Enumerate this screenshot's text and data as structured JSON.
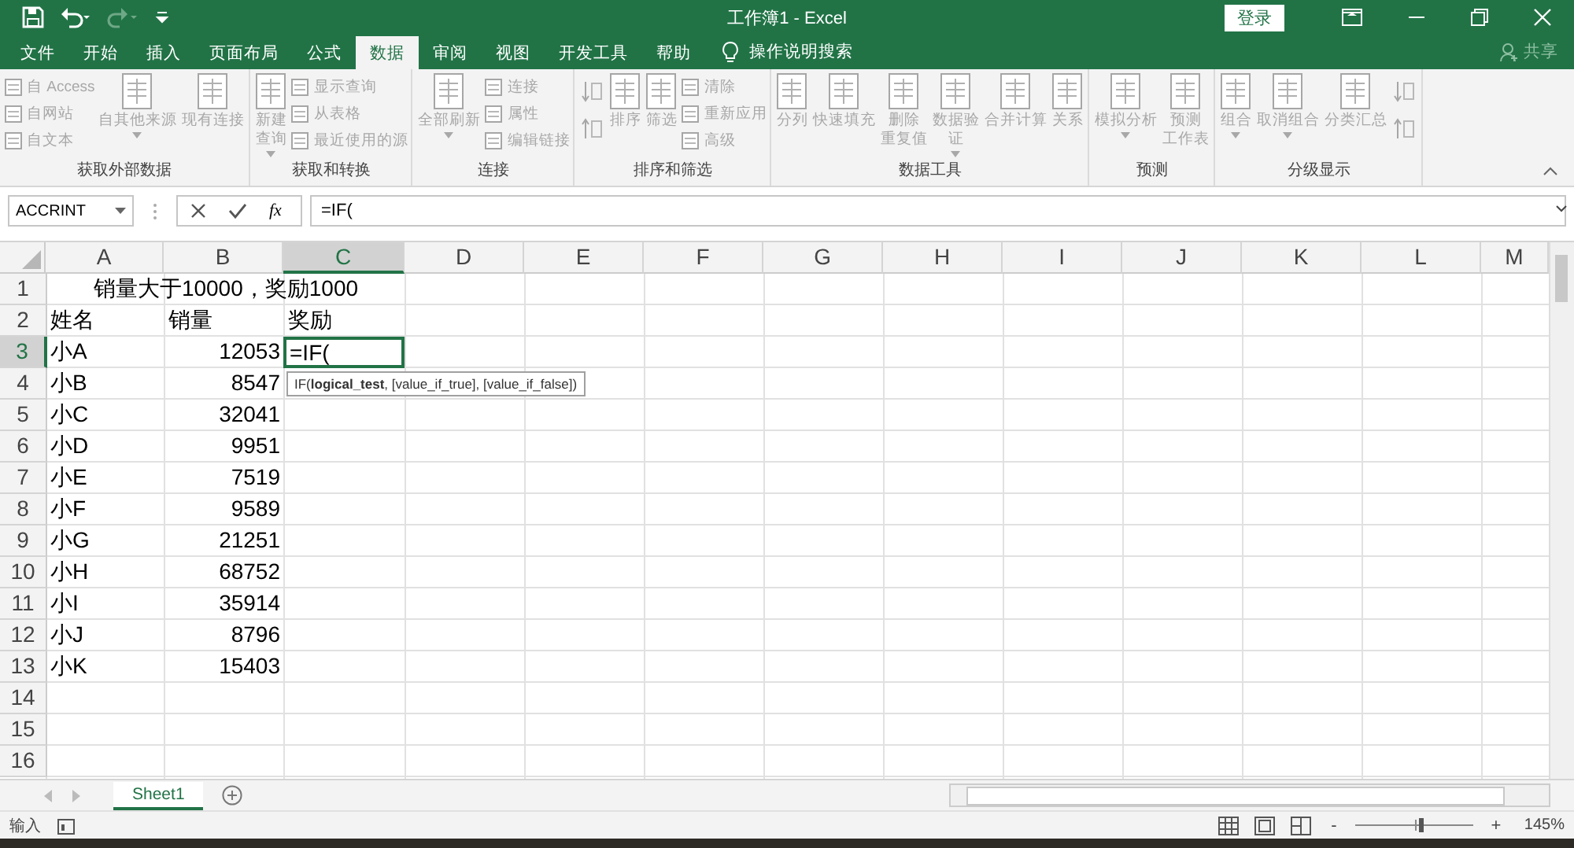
{
  "window": {
    "title": "工作簿1 - Excel",
    "signin": "登录",
    "share": "共享"
  },
  "tabs": [
    {
      "label": "文件",
      "selected": false
    },
    {
      "label": "开始",
      "selected": false
    },
    {
      "label": "插入",
      "selected": false
    },
    {
      "label": "页面布局",
      "selected": false
    },
    {
      "label": "公式",
      "selected": false
    },
    {
      "label": "数据",
      "selected": true
    },
    {
      "label": "审阅",
      "selected": false
    },
    {
      "label": "视图",
      "selected": false
    },
    {
      "label": "开发工具",
      "selected": false
    },
    {
      "label": "帮助",
      "selected": false
    }
  ],
  "tell_me": "操作说明搜索",
  "ribbon": {
    "disabled": true,
    "groups": [
      {
        "label": "获取外部数据",
        "columns": [
          {
            "kind": "stack",
            "items": [
              "自 Access",
              "自网站",
              "自文本"
            ]
          },
          {
            "kind": "large",
            "lines": [
              "自其他来源"
            ],
            "dropdown": true
          },
          {
            "kind": "large",
            "lines": [
              "现有连接"
            ],
            "dropdown": false
          }
        ]
      },
      {
        "label": "获取和转换",
        "columns": [
          {
            "kind": "large",
            "lines": [
              "新建",
              "查询"
            ],
            "dropdown": true
          },
          {
            "kind": "stack",
            "items": [
              "显示查询",
              "从表格",
              "最近使用的源"
            ]
          }
        ]
      },
      {
        "label": "连接",
        "columns": [
          {
            "kind": "large",
            "lines": [
              "全部刷新"
            ],
            "dropdown": true
          },
          {
            "kind": "stack",
            "items": [
              "连接",
              "属性",
              "编辑链接"
            ]
          }
        ]
      },
      {
        "label": "排序和筛选",
        "columns": [
          {
            "kind": "icons"
          },
          {
            "kind": "large",
            "lines": [
              "排序"
            ],
            "dropdown": false
          },
          {
            "kind": "large",
            "lines": [
              "筛选"
            ],
            "dropdown": false
          },
          {
            "kind": "stack",
            "items": [
              "清除",
              "重新应用",
              "高级"
            ]
          }
        ]
      },
      {
        "label": "数据工具",
        "columns": [
          {
            "kind": "large",
            "lines": [
              "分列"
            ],
            "dropdown": false
          },
          {
            "kind": "large",
            "lines": [
              "快速填充"
            ],
            "dropdown": false
          },
          {
            "kind": "large",
            "lines": [
              "删除",
              "重复值"
            ],
            "dropdown": false
          },
          {
            "kind": "large",
            "lines": [
              "数据验",
              "证"
            ],
            "dropdown": true
          },
          {
            "kind": "large",
            "lines": [
              "合并计算"
            ],
            "dropdown": false
          },
          {
            "kind": "large",
            "lines": [
              "关系"
            ],
            "dropdown": false
          }
        ]
      },
      {
        "label": "预测",
        "columns": [
          {
            "kind": "large",
            "lines": [
              "模拟分析"
            ],
            "dropdown": true
          },
          {
            "kind": "large",
            "lines": [
              "预测",
              "工作表"
            ],
            "dropdown": false
          }
        ]
      },
      {
        "label": "分级显示",
        "columns": [
          {
            "kind": "large",
            "lines": [
              "组合"
            ],
            "dropdown": true
          },
          {
            "kind": "large",
            "lines": [
              "取消组合"
            ],
            "dropdown": true
          },
          {
            "kind": "large",
            "lines": [
              "分类汇总"
            ],
            "dropdown": false
          },
          {
            "kind": "icons"
          }
        ]
      }
    ]
  },
  "formula_bar": {
    "name_box": "ACCRINT",
    "fx": "fx",
    "value": "=IF("
  },
  "columns": [
    {
      "label": "A",
      "selected": false
    },
    {
      "label": "B",
      "selected": false
    },
    {
      "label": "C",
      "selected": true
    },
    {
      "label": "D",
      "selected": false
    },
    {
      "label": "E",
      "selected": false
    },
    {
      "label": "F",
      "selected": false
    },
    {
      "label": "G",
      "selected": false
    },
    {
      "label": "H",
      "selected": false
    },
    {
      "label": "I",
      "selected": false
    },
    {
      "label": "J",
      "selected": false
    },
    {
      "label": "K",
      "selected": false
    },
    {
      "label": "L",
      "selected": false
    },
    {
      "label": "M",
      "selected": false
    }
  ],
  "rows": [
    {
      "number": "1",
      "selected": false,
      "cells": [
        {
          "text": "销量大于10000，奖励1000",
          "kind": "heading",
          "selected": false
        }
      ]
    },
    {
      "number": "2",
      "selected": false,
      "cells": [
        {
          "text": "姓名",
          "kind": "text",
          "selected": false
        },
        {
          "text": "销量",
          "kind": "text",
          "selected": false
        },
        {
          "text": "奖励",
          "kind": "text",
          "selected": false
        }
      ]
    },
    {
      "number": "3",
      "selected": true,
      "cells": [
        {
          "text": "小A",
          "kind": "text",
          "selected": false
        },
        {
          "text": "12053",
          "kind": "number",
          "selected": false
        },
        {
          "text": "=IF(",
          "kind": "text",
          "selected": true
        }
      ]
    },
    {
      "number": "4",
      "selected": false,
      "cells": [
        {
          "text": "小B",
          "kind": "text",
          "selected": false
        },
        {
          "text": "8547",
          "kind": "number",
          "selected": false
        }
      ]
    },
    {
      "number": "5",
      "selected": false,
      "cells": [
        {
          "text": "小C",
          "kind": "text",
          "selected": false
        },
        {
          "text": "32041",
          "kind": "number",
          "selected": false
        }
      ]
    },
    {
      "number": "6",
      "selected": false,
      "cells": [
        {
          "text": "小D",
          "kind": "text",
          "selected": false
        },
        {
          "text": "9951",
          "kind": "number",
          "selected": false
        }
      ]
    },
    {
      "number": "7",
      "selected": false,
      "cells": [
        {
          "text": "小E",
          "kind": "text",
          "selected": false
        },
        {
          "text": "7519",
          "kind": "number",
          "selected": false
        }
      ]
    },
    {
      "number": "8",
      "selected": false,
      "cells": [
        {
          "text": "小F",
          "kind": "text",
          "selected": false
        },
        {
          "text": "9589",
          "kind": "number",
          "selected": false
        }
      ]
    },
    {
      "number": "9",
      "selected": false,
      "cells": [
        {
          "text": "小G",
          "kind": "text",
          "selected": false
        },
        {
          "text": "21251",
          "kind": "number",
          "selected": false
        }
      ]
    },
    {
      "number": "10",
      "selected": false,
      "cells": [
        {
          "text": "小H",
          "kind": "text",
          "selected": false
        },
        {
          "text": "68752",
          "kind": "number",
          "selected": false
        }
      ]
    },
    {
      "number": "11",
      "selected": false,
      "cells": [
        {
          "text": "小I",
          "kind": "text",
          "selected": false
        },
        {
          "text": "35914",
          "kind": "number",
          "selected": false
        }
      ]
    },
    {
      "number": "12",
      "selected": false,
      "cells": [
        {
          "text": "小J",
          "kind": "text",
          "selected": false
        },
        {
          "text": "8796",
          "kind": "number",
          "selected": false
        }
      ]
    },
    {
      "number": "13",
      "selected": false,
      "cells": [
        {
          "text": "小K",
          "kind": "text",
          "selected": false
        },
        {
          "text": "15403",
          "kind": "number",
          "selected": false
        }
      ]
    },
    {
      "number": "14",
      "selected": false,
      "cells": []
    },
    {
      "number": "15",
      "selected": false,
      "cells": []
    },
    {
      "number": "16",
      "selected": false,
      "cells": []
    }
  ],
  "tooltip": "IF(**logical_test**, [value_if_true], [value_if_false])",
  "sheets": [
    {
      "label": "Sheet1",
      "selected": true
    }
  ],
  "status_bar": {
    "mode": "输入",
    "zoom_out": "-",
    "zoom_in": "+",
    "zoom": "145%",
    "level": 0.55
  }
}
